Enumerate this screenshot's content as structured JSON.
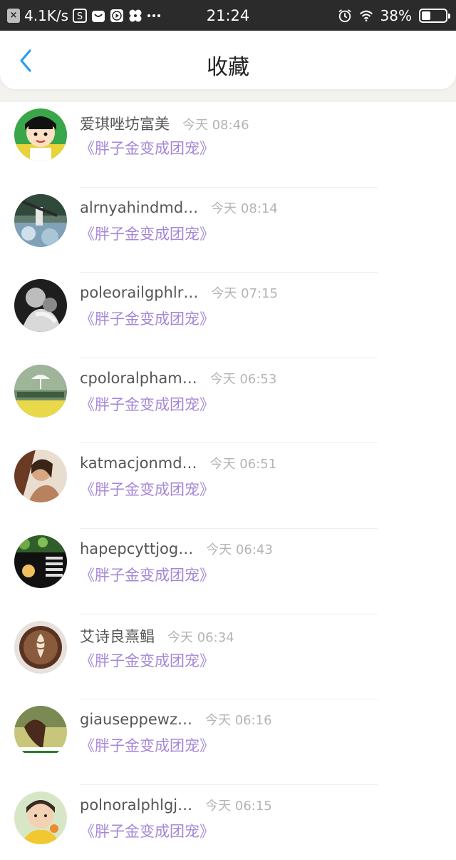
{
  "status_bar": {
    "notification_icon": "x-box-icon",
    "net_speed": "4.1K/s",
    "time": "21:24",
    "battery_percent": "38%",
    "battery_level": 0.38
  },
  "header": {
    "title": "收藏",
    "back_icon": "chevron-left-icon"
  },
  "colors": {
    "accent_blue": "#2b9cf0",
    "book_purple": "#a687d6",
    "name_gray": "#555555",
    "time_gray": "#b4b4b4"
  },
  "items": [
    {
      "name": "爱琪唑坊富美",
      "time": "今天 08:46",
      "book": "《胖子金变成团宠》"
    },
    {
      "name": "alrnyahindmd…",
      "time": "今天 08:14",
      "book": "《胖子金变成团宠》"
    },
    {
      "name": "poleorailgphlr…",
      "time": "今天 07:15",
      "book": "《胖子金变成团宠》"
    },
    {
      "name": "cpoloralpham…",
      "time": "今天 06:53",
      "book": "《胖子金变成团宠》"
    },
    {
      "name": "katmacjonmd…",
      "time": "今天 06:51",
      "book": "《胖子金变成团宠》"
    },
    {
      "name": "hapepcyttjog…",
      "time": "今天 06:43",
      "book": "《胖子金变成团宠》"
    },
    {
      "name": "艾诗良熹鲳",
      "time": "今天 06:34",
      "book": "《胖子金变成团宠》"
    },
    {
      "name": "giauseppewz…",
      "time": "今天 06:16",
      "book": "《胖子金变成团宠》"
    },
    {
      "name": "polnoralphlgj…",
      "time": "今天 06:15",
      "book": "《胖子金变成团宠》"
    }
  ]
}
